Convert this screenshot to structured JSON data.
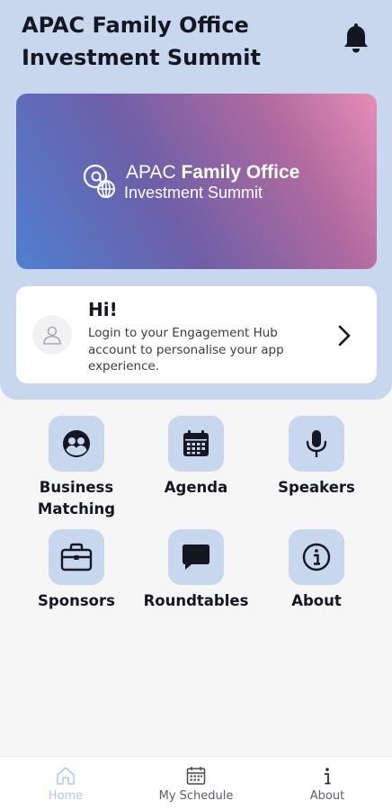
{
  "header": {
    "title": "APAC Family Office Investment Summit"
  },
  "banner": {
    "line1_regular": "APAC ",
    "line1_bold": "Family Office",
    "line2": "Investment Summit"
  },
  "login_card": {
    "greeting": "Hi!",
    "message": "Login to your Engagement Hub account to personalise your app experience."
  },
  "menu": {
    "items": [
      {
        "label": "Business Matching",
        "icon": "business-matching-icon"
      },
      {
        "label": "Agenda",
        "icon": "calendar-icon"
      },
      {
        "label": "Speakers",
        "icon": "microphone-icon"
      },
      {
        "label": "Sponsors",
        "icon": "briefcase-icon"
      },
      {
        "label": "Roundtables",
        "icon": "chat-bubble-icon"
      },
      {
        "label": "About",
        "icon": "info-icon"
      }
    ]
  },
  "bottom_nav": {
    "items": [
      {
        "label": "Home",
        "icon": "home-icon",
        "active": true
      },
      {
        "label": "My Schedule",
        "icon": "calendar-icon",
        "active": false
      },
      {
        "label": "About",
        "icon": "info-icon",
        "active": false
      }
    ]
  },
  "colors": {
    "panel": "#c8d6ee",
    "icon_tile": "#c8d6ee",
    "icon_fill": "#141722",
    "active_nav": "#b5c8ef"
  }
}
